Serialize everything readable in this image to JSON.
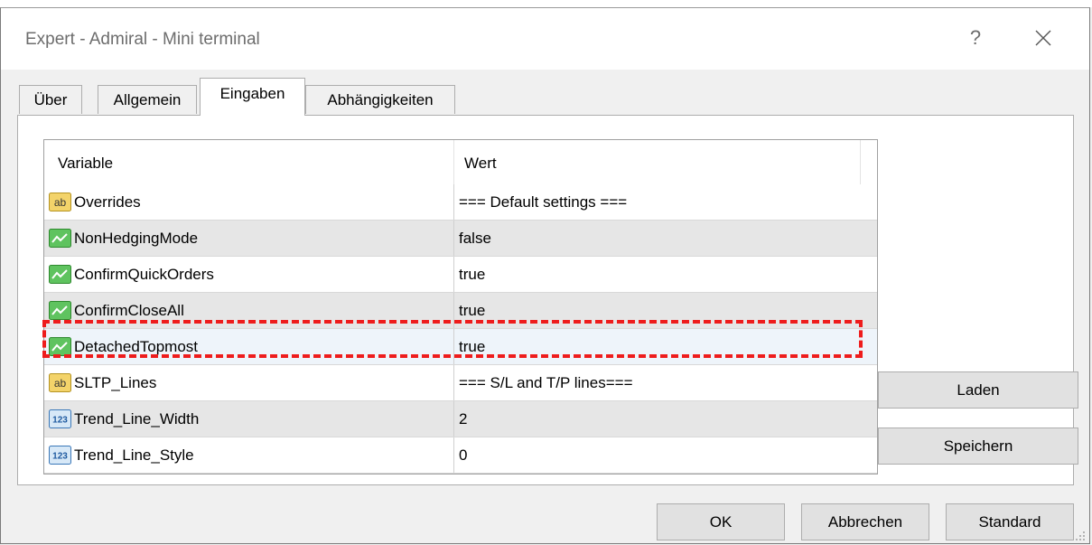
{
  "window": {
    "title": "Expert - Admiral - Mini terminal",
    "help_glyph": "?"
  },
  "tabs": [
    {
      "label": "Über",
      "active": false
    },
    {
      "label": "Allgemein",
      "active": false
    },
    {
      "label": "Eingaben",
      "active": true
    },
    {
      "label": "Abhängigkeiten",
      "active": false
    }
  ],
  "table": {
    "headers": {
      "variable": "Variable",
      "value": "Wert"
    },
    "rows": [
      {
        "icon": "string-type-icon",
        "name": "Overrides",
        "value": "=== Default settings ===",
        "selected": false
      },
      {
        "icon": "bool-type-icon",
        "name": "NonHedgingMode",
        "value": "false",
        "selected": false
      },
      {
        "icon": "bool-type-icon",
        "name": "ConfirmQuickOrders",
        "value": "true",
        "selected": false
      },
      {
        "icon": "bool-type-icon",
        "name": "ConfirmCloseAll",
        "value": "true",
        "selected": false
      },
      {
        "icon": "bool-type-icon",
        "name": "DetachedTopmost",
        "value": "true",
        "selected": true
      },
      {
        "icon": "string-type-icon",
        "name": "SLTP_Lines",
        "value": "=== S/L and T/P lines===",
        "selected": false
      },
      {
        "icon": "int-type-icon",
        "name": "Trend_Line_Width",
        "value": "2",
        "selected": false
      },
      {
        "icon": "int-type-icon",
        "name": "Trend_Line_Style",
        "value": "0",
        "selected": false
      }
    ]
  },
  "buttons": {
    "load": "Laden",
    "save": "Speichern",
    "ok": "OK",
    "cancel": "Abbrechen",
    "default": "Standard"
  },
  "colors": {
    "highlight": "#ee1c1c",
    "selected_row": "#eef4fa",
    "alt_row": "#e6e6e6"
  }
}
